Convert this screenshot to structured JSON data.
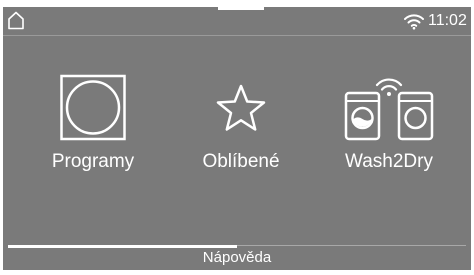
{
  "status_bar": {
    "home_icon": "home-icon",
    "wifi_icon": "wifi-icon",
    "time": "11:02"
  },
  "tiles": [
    {
      "label": "Programy",
      "icon": "drum-icon"
    },
    {
      "label": "Oblíbené",
      "icon": "star-icon"
    },
    {
      "label": "Wash2Dry",
      "icon": "washer-dryer-wifi-icon"
    }
  ],
  "help": {
    "label": "Nápověda",
    "progress": 0.5
  },
  "colors": {
    "background": "#7a7a7a",
    "foreground": "#ffffff"
  }
}
